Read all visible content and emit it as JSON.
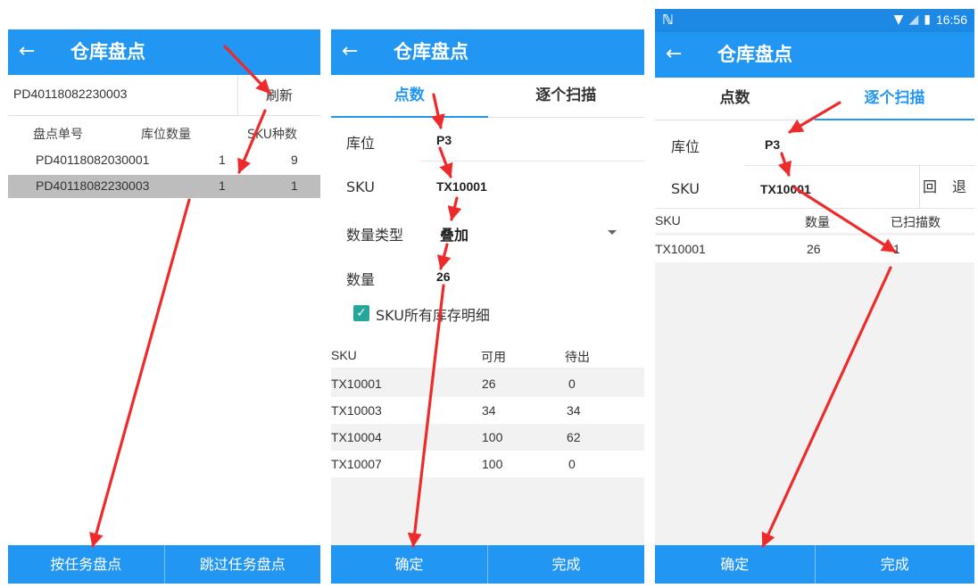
{
  "screens": [
    {
      "title": "仓库盘点",
      "order_input_value": "PD40118082230003",
      "refresh_label": "刷新",
      "table": {
        "headers": [
          "盘点单号",
          "库位数量",
          "SKU种数"
        ],
        "rows": [
          {
            "order": "PD40118082030001",
            "locations": "1",
            "sku_types": "9"
          },
          {
            "order": "PD40118082230003",
            "locations": "1",
            "sku_types": "1"
          }
        ]
      },
      "buttons": [
        "按任务盘点",
        "跳过任务盘点"
      ]
    },
    {
      "title": "仓库盘点",
      "tabs": [
        "点数",
        "逐个扫描"
      ],
      "active_tab": "点数",
      "fields": [
        {
          "label": "库位",
          "value": "P3"
        },
        {
          "label": "SKU",
          "value": "TX10001"
        },
        {
          "label": "数量类型",
          "value": "叠加"
        },
        {
          "label": "数量",
          "value": "26"
        }
      ],
      "checkbox": {
        "label": "SKU所有库存明细",
        "checked": true
      },
      "table": {
        "headers": [
          "SKU",
          "可用",
          "待出"
        ],
        "rows": [
          [
            "TX10001",
            "26",
            "0"
          ],
          [
            "TX10003",
            "34",
            "34"
          ],
          [
            "TX10004",
            "100",
            "62"
          ],
          [
            "TX10007",
            "100",
            "0"
          ]
        ]
      },
      "buttons": [
        "确定",
        "完成"
      ]
    },
    {
      "status_bar": {
        "time": "16:56"
      },
      "title": "仓库盘点",
      "tabs": [
        "点数",
        "逐个扫描"
      ],
      "active_tab": "逐个扫描",
      "fields": [
        {
          "label": "库位",
          "value": "P3"
        },
        {
          "label": "SKU",
          "value": "TX10001"
        }
      ],
      "back_label": "回 退",
      "table": {
        "headers": [
          "SKU",
          "数量",
          "已扫描数"
        ],
        "rows": [
          [
            "TX10001",
            "26",
            "1"
          ]
        ]
      },
      "buttons": [
        "确定",
        "完成"
      ]
    }
  ],
  "colors": {
    "primary": "#2196f3",
    "status_bar": "#1e88e5",
    "selected_row": "#bdbdbd",
    "checkbox": "#26a69a",
    "annotation_arrow": "#ee2b2b"
  }
}
